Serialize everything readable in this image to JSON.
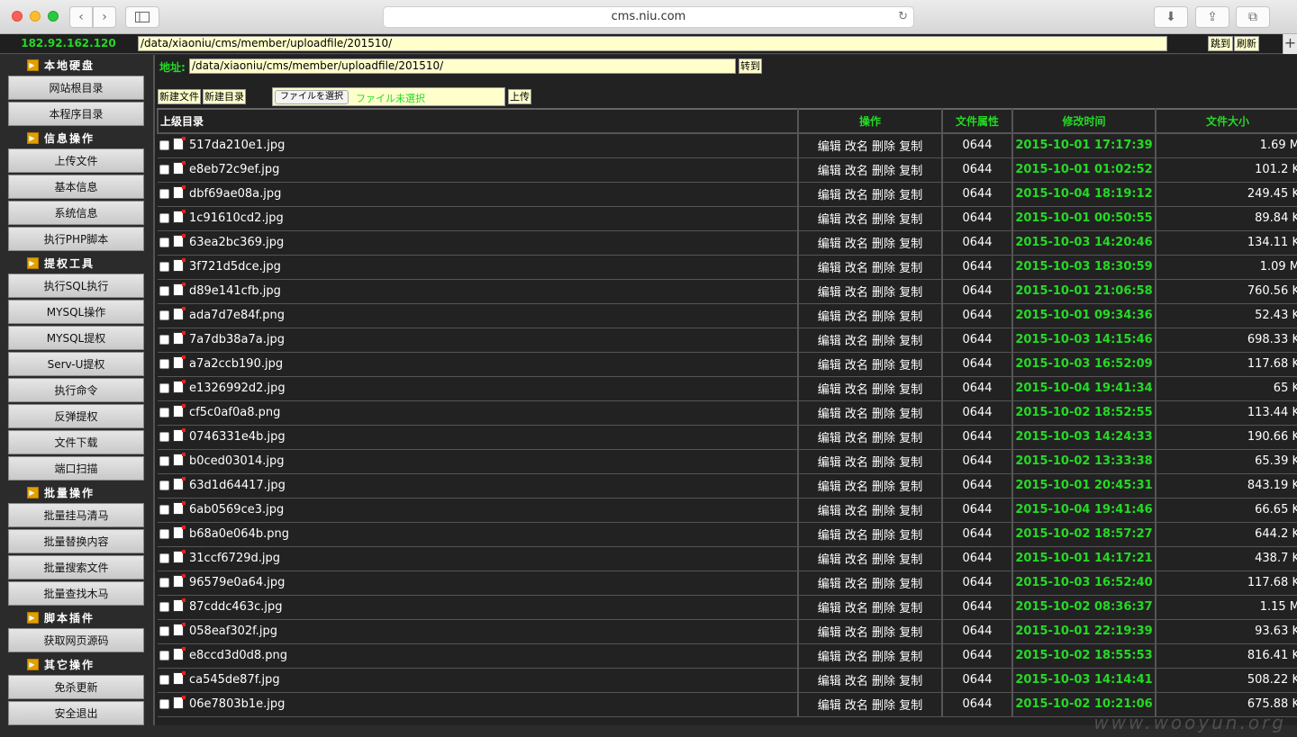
{
  "browser": {
    "url": "cms.niu.com",
    "back": "‹",
    "forward": "›",
    "sidebar_icon": "sidebar-icon",
    "reload": "↻",
    "download": "⬇",
    "share": "⇪",
    "tabs": "⧉",
    "new_tab": "+"
  },
  "top": {
    "ip": "182.92.162.120",
    "path": "/data/xiaoniu/cms/member/uploadfile/201510/",
    "go": "跳到",
    "refresh": "刷新"
  },
  "sidebar": {
    "sections": [
      {
        "title": "本地硬盘",
        "items": [
          "网站根目录",
          "本程序目录"
        ]
      },
      {
        "title": "信息操作",
        "items": [
          "上传文件",
          "基本信息",
          "系统信息",
          "执行PHP脚本"
        ]
      },
      {
        "title": "提权工具",
        "items": [
          "执行SQL执行",
          "MYSQL操作",
          "MYSQL提权",
          "Serv-U提权",
          "执行命令",
          "反弹提权",
          "文件下载",
          "端口扫描"
        ]
      },
      {
        "title": "批量操作",
        "items": [
          "批量挂马清马",
          "批量替换内容",
          "批量搜索文件",
          "批量查找木马"
        ]
      },
      {
        "title": "脚本插件",
        "items": [
          "获取网页源码"
        ]
      },
      {
        "title": "其它操作",
        "items": [
          "免杀更新",
          "安全退出"
        ]
      }
    ]
  },
  "main": {
    "addr_label": "地址:",
    "addr_value": "/data/xiaoniu/cms/member/uploadfile/201510/",
    "go_button": "转到",
    "new_file": "新建文件",
    "new_dir": "新建目录",
    "choose_file": "ファイルを選択",
    "no_file": "ファイル未選択",
    "upload": "上传"
  },
  "table": {
    "headers": {
      "name": "上级目录",
      "ops": "操作",
      "perm": "文件属性",
      "mtime": "修改时间",
      "size": "文件大小"
    },
    "ops": "编辑 改名 删除 复制",
    "rows": [
      {
        "name": "517da210e1.jpg",
        "perm": "0644",
        "mtime": "2015-10-01 17:17:39",
        "size": "1.69 M"
      },
      {
        "name": "e8eb72c9ef.jpg",
        "perm": "0644",
        "mtime": "2015-10-01 01:02:52",
        "size": "101.2 K"
      },
      {
        "name": "dbf69ae08a.jpg",
        "perm": "0644",
        "mtime": "2015-10-04 18:19:12",
        "size": "249.45 K"
      },
      {
        "name": "1c91610cd2.jpg",
        "perm": "0644",
        "mtime": "2015-10-01 00:50:55",
        "size": "89.84 K"
      },
      {
        "name": "63ea2bc369.jpg",
        "perm": "0644",
        "mtime": "2015-10-03 14:20:46",
        "size": "134.11 K"
      },
      {
        "name": "3f721d5dce.jpg",
        "perm": "0644",
        "mtime": "2015-10-03 18:30:59",
        "size": "1.09 M"
      },
      {
        "name": "d89e141cfb.jpg",
        "perm": "0644",
        "mtime": "2015-10-01 21:06:58",
        "size": "760.56 K"
      },
      {
        "name": "ada7d7e84f.png",
        "perm": "0644",
        "mtime": "2015-10-01 09:34:36",
        "size": "52.43 K"
      },
      {
        "name": "7a7db38a7a.jpg",
        "perm": "0644",
        "mtime": "2015-10-03 14:15:46",
        "size": "698.33 K"
      },
      {
        "name": "a7a2ccb190.jpg",
        "perm": "0644",
        "mtime": "2015-10-03 16:52:09",
        "size": "117.68 K"
      },
      {
        "name": "e1326992d2.jpg",
        "perm": "0644",
        "mtime": "2015-10-04 19:41:34",
        "size": "65 K"
      },
      {
        "name": "cf5c0af0a8.png",
        "perm": "0644",
        "mtime": "2015-10-02 18:52:55",
        "size": "113.44 K"
      },
      {
        "name": "0746331e4b.jpg",
        "perm": "0644",
        "mtime": "2015-10-03 14:24:33",
        "size": "190.66 K"
      },
      {
        "name": "b0ced03014.jpg",
        "perm": "0644",
        "mtime": "2015-10-02 13:33:38",
        "size": "65.39 K"
      },
      {
        "name": "63d1d64417.jpg",
        "perm": "0644",
        "mtime": "2015-10-01 20:45:31",
        "size": "843.19 K"
      },
      {
        "name": "6ab0569ce3.jpg",
        "perm": "0644",
        "mtime": "2015-10-04 19:41:46",
        "size": "66.65 K"
      },
      {
        "name": "b68a0e064b.png",
        "perm": "0644",
        "mtime": "2015-10-02 18:57:27",
        "size": "644.2 K"
      },
      {
        "name": "31ccf6729d.jpg",
        "perm": "0644",
        "mtime": "2015-10-01 14:17:21",
        "size": "438.7 K"
      },
      {
        "name": "96579e0a64.jpg",
        "perm": "0644",
        "mtime": "2015-10-03 16:52:40",
        "size": "117.68 K"
      },
      {
        "name": "87cddc463c.jpg",
        "perm": "0644",
        "mtime": "2015-10-02 08:36:37",
        "size": "1.15 M"
      },
      {
        "name": "058eaf302f.jpg",
        "perm": "0644",
        "mtime": "2015-10-01 22:19:39",
        "size": "93.63 K"
      },
      {
        "name": "e8ccd3d0d8.png",
        "perm": "0644",
        "mtime": "2015-10-02 18:55:53",
        "size": "816.41 K"
      },
      {
        "name": "ca545de87f.jpg",
        "perm": "0644",
        "mtime": "2015-10-03 14:14:41",
        "size": "508.22 K"
      },
      {
        "name": "06e7803b1e.jpg",
        "perm": "0644",
        "mtime": "2015-10-02 10:21:06",
        "size": "675.88 K"
      }
    ]
  },
  "watermark": "www.wooyun.org"
}
